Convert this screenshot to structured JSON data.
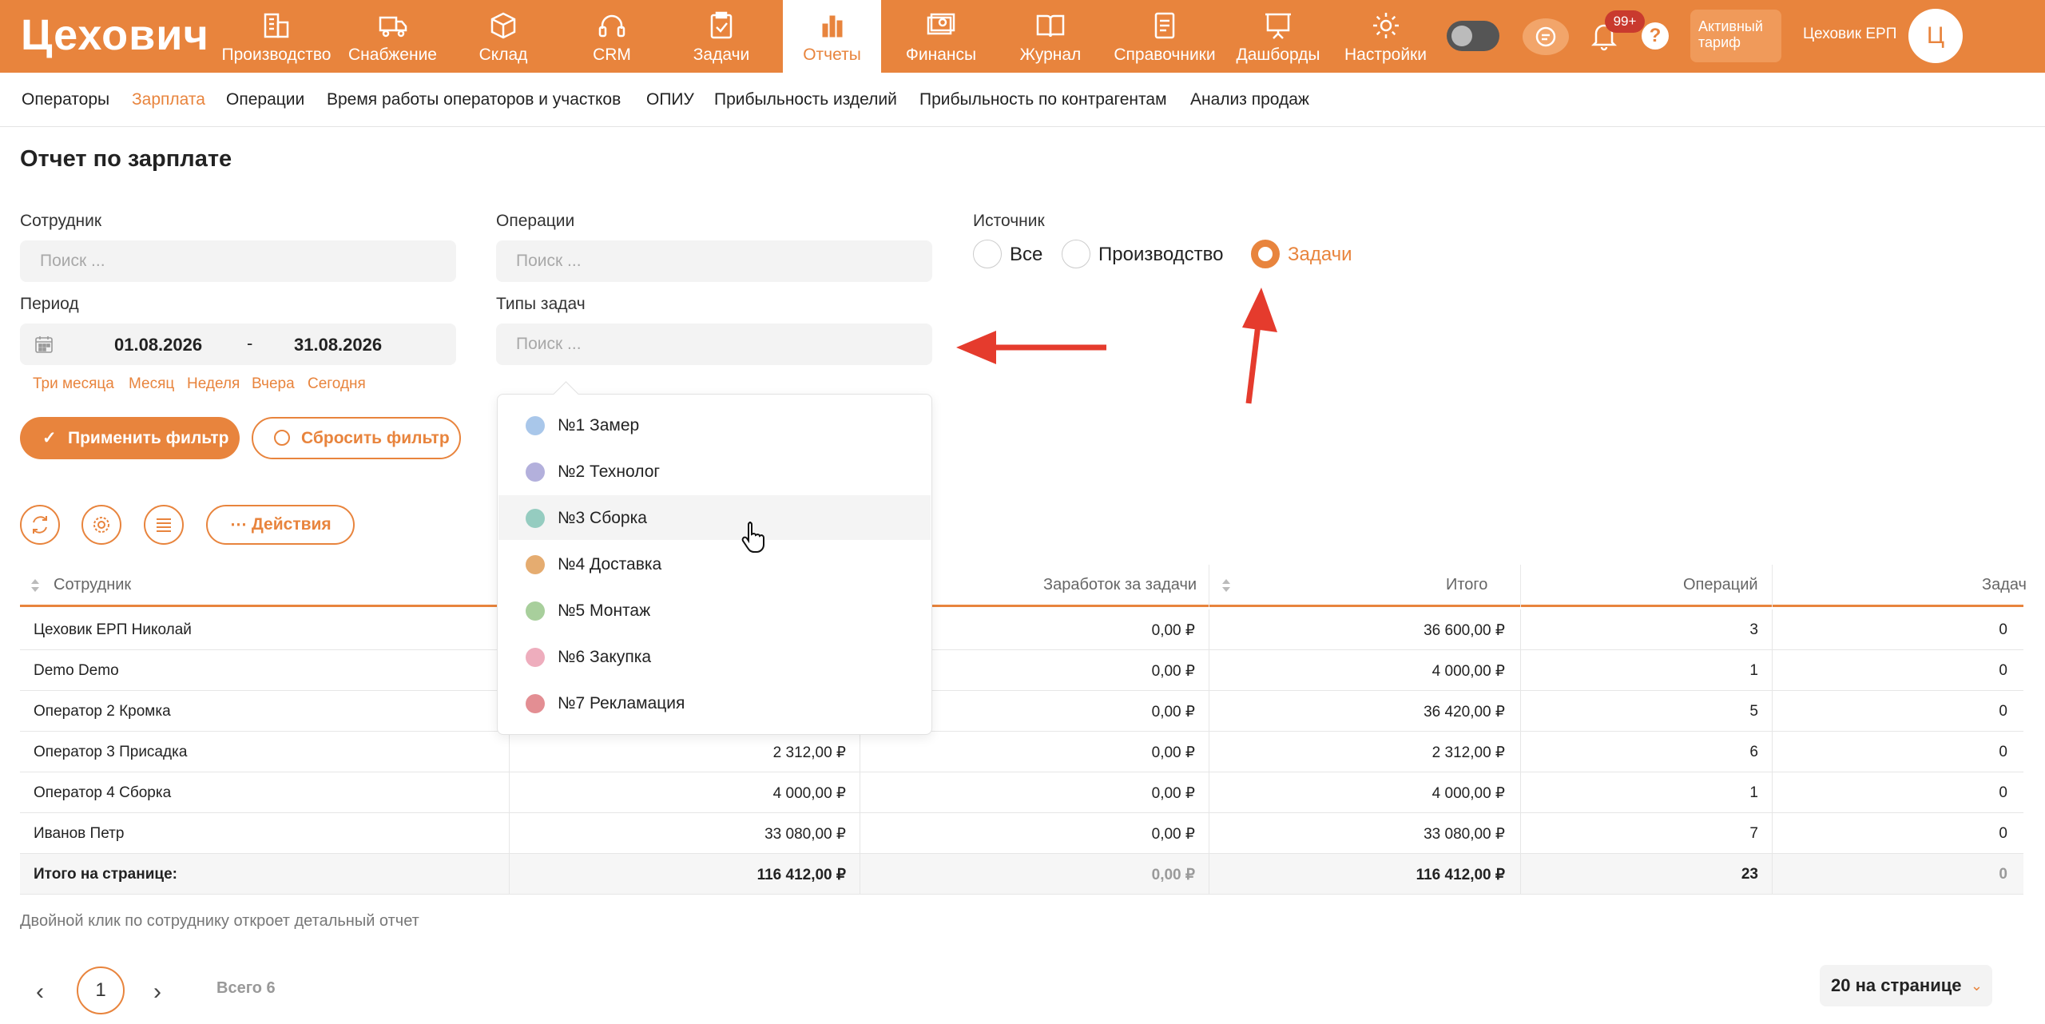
{
  "app": {
    "logo_text": "Цехович",
    "nav": [
      {
        "label": "Производство",
        "icon": "building-icon"
      },
      {
        "label": "Снабжение",
        "icon": "truck-icon"
      },
      {
        "label": "Склад",
        "icon": "box-icon"
      },
      {
        "label": "CRM",
        "icon": "headset-icon"
      },
      {
        "label": "Задачи",
        "icon": "clipboard-check-icon"
      },
      {
        "label": "Отчеты",
        "icon": "bar-chart-icon"
      },
      {
        "label": "Финансы",
        "icon": "money-icon"
      },
      {
        "label": "Журнал",
        "icon": "book-icon"
      },
      {
        "label": "Справочники",
        "icon": "document-icon"
      },
      {
        "label": "Дашборды",
        "icon": "presentation-icon"
      },
      {
        "label": "Настройки",
        "icon": "gear-icon"
      }
    ],
    "active_nav": "Отчеты",
    "notifications_badge": "99+",
    "help_label": "?",
    "tariff_label": "Активный тариф",
    "company_name": "Цеховик ЕРП",
    "avatar_letter": "Ц",
    "accent_color": "#e8843d"
  },
  "subnav": {
    "items": [
      "Операторы",
      "Зарплата",
      "Операции",
      "Время работы операторов и участков",
      "ОПИУ",
      "Прибыльность изделий",
      "Прибыльность по контрагентам",
      "Анализ продаж"
    ],
    "active": "Зарплата"
  },
  "page": {
    "title": "Отчет по зарплате"
  },
  "filters": {
    "employee_label": "Сотрудник",
    "employee_placeholder": "Поиск ...",
    "operations_label": "Операции",
    "operations_placeholder": "Поиск ...",
    "period_label": "Период",
    "date_from": "01.08.2026",
    "date_separator": "-",
    "date_to": "31.08.2026",
    "quick_periods": [
      "Три месяца",
      "Месяц",
      "Неделя",
      "Вчера",
      "Сегодня"
    ],
    "task_types_label": "Типы задач",
    "task_types_placeholder": "Поиск ...",
    "source_label": "Источник",
    "source_options": [
      "Все",
      "Производство",
      "Задачи"
    ],
    "source_selected": "Задачи",
    "apply_label": "Применить фильтр",
    "reset_label": "Сбросить фильтр"
  },
  "task_types_dropdown": [
    {
      "label": "№1 Замер",
      "color": "#a9c7ea"
    },
    {
      "label": "№2 Технолог",
      "color": "#b3b0dc"
    },
    {
      "label": "№3 Сборка",
      "color": "#95ccc0"
    },
    {
      "label": "№4 Доставка",
      "color": "#e5ac70"
    },
    {
      "label": "№5 Монтаж",
      "color": "#a8cf9c"
    },
    {
      "label": "№6 Закупка",
      "color": "#eeadbd"
    },
    {
      "label": "№7 Рекламация",
      "color": "#e38e93"
    }
  ],
  "toolbar": {
    "actions_label": "Действия"
  },
  "table": {
    "columns": [
      "Сотрудник",
      "",
      "Заработок за задачи",
      "Итого",
      "Операций",
      "Задач"
    ],
    "rows": [
      [
        "Цеховик ЕРП Николай",
        "",
        "0,00 ₽",
        "36 600,00 ₽",
        "3",
        "0"
      ],
      [
        "Demo Demo",
        "",
        "0,00 ₽",
        "4 000,00 ₽",
        "1",
        "0"
      ],
      [
        "Оператор 2 Кромка",
        "",
        "0,00 ₽",
        "36 420,00 ₽",
        "5",
        "0"
      ],
      [
        "Оператор 3 Присадка",
        "2 312,00 ₽",
        "0,00 ₽",
        "2 312,00 ₽",
        "6",
        "0"
      ],
      [
        "Оператор 4 Сборка",
        "4 000,00 ₽",
        "0,00 ₽",
        "4 000,00 ₽",
        "1",
        "0"
      ],
      [
        "Иванов Петр",
        "33 080,00 ₽",
        "0,00 ₽",
        "33 080,00 ₽",
        "7",
        "0"
      ]
    ],
    "total": [
      "Итого на странице:",
      "116 412,00 ₽",
      "0,00 ₽",
      "116 412,00 ₽",
      "23",
      "0"
    ]
  },
  "hint": "Двойной клик по сотруднику откроет детальный отчет",
  "pagination": {
    "current_page": "1",
    "total_label": "Всего 6",
    "per_page": "20 на странице"
  }
}
